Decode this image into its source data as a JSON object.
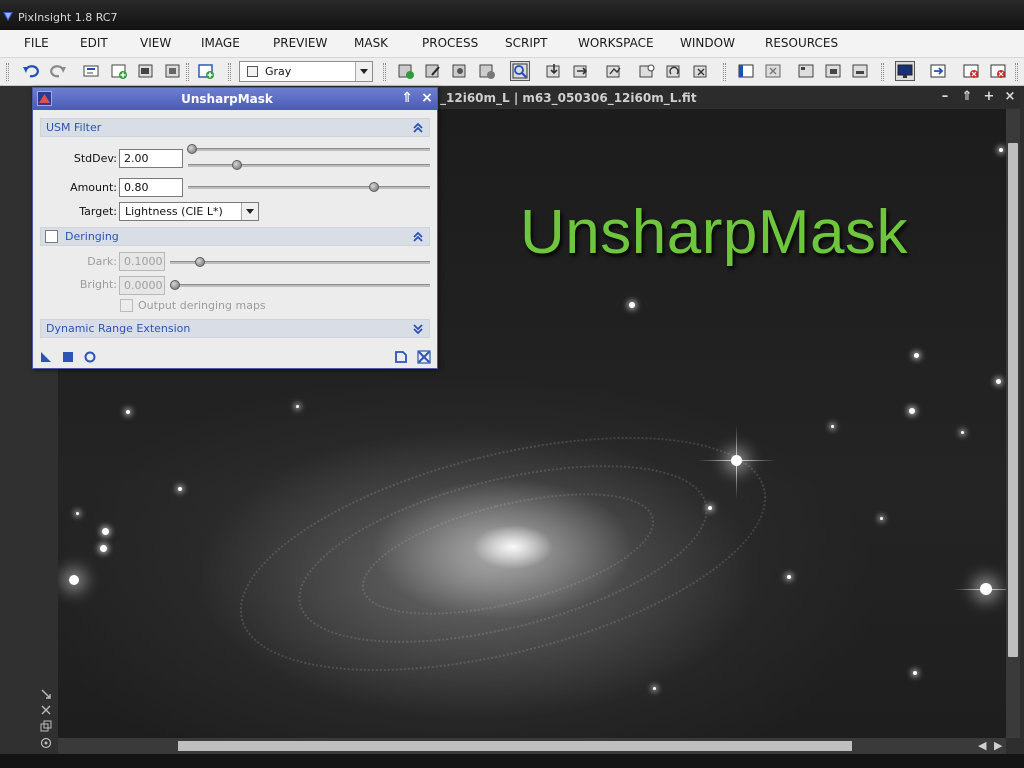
{
  "window": {
    "title": "PixInsight 1.8 RC7"
  },
  "menu": {
    "items": [
      "FILE",
      "EDIT",
      "VIEW",
      "IMAGE",
      "PREVIEW",
      "MASK",
      "PROCESS",
      "SCRIPT",
      "WORKSPACE",
      "WINDOW",
      "RESOURCES"
    ]
  },
  "toolbar": {
    "color_space": "Gray"
  },
  "image_window": {
    "title": "_12i60m_L | m63_050306_12i60m_L.fit"
  },
  "overlay": {
    "caption": "UnsharpMask",
    "color": "#6ec63c"
  },
  "dialog": {
    "title": "UnsharpMask",
    "usm_section": {
      "label": "USM Filter",
      "stddev_label": "StdDev:",
      "stddev_value": "2.00",
      "amount_label": "Amount:",
      "amount_value": "0.80",
      "target_label": "Target:",
      "target_value": "Lightness (CIE L*)"
    },
    "deringing_section": {
      "label": "Deringing",
      "checked": false,
      "dark_label": "Dark:",
      "dark_value": "0.1000",
      "bright_label": "Bright:",
      "bright_value": "0.0000",
      "output_maps_label": "Output deringing maps"
    },
    "dre_section": {
      "label": "Dynamic Range Extension"
    }
  },
  "colors": {
    "accent": "#4a5bb4",
    "section_text": "#2a55b5"
  }
}
